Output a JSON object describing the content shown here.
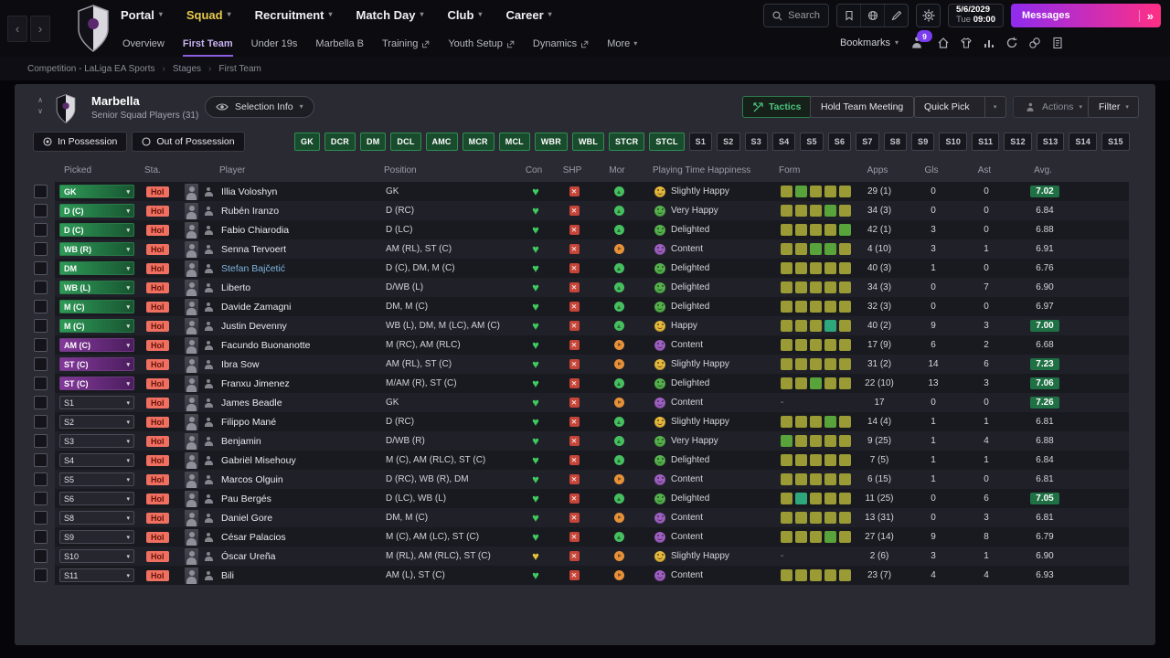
{
  "topbar": {
    "menus": [
      {
        "label": "Portal",
        "active": false
      },
      {
        "label": "Squad",
        "active": true
      },
      {
        "label": "Recruitment",
        "active": false
      },
      {
        "label": "Match Day",
        "active": false
      },
      {
        "label": "Club",
        "active": false
      },
      {
        "label": "Career",
        "active": false
      }
    ],
    "search_label": "Search",
    "icons": [
      "bookmark-icon",
      "globe-icon",
      "pencil-icon",
      "gear-icon"
    ],
    "date": {
      "date": "5/6/2029",
      "day": "Tue",
      "time": "09:00"
    },
    "messages_label": "Messages",
    "messages_arrows": "»"
  },
  "subnav": {
    "tabs": [
      {
        "label": "Overview",
        "selected": false,
        "external": false,
        "dropdown": false
      },
      {
        "label": "First Team",
        "selected": true,
        "external": false,
        "dropdown": false
      },
      {
        "label": "Under 19s",
        "selected": false,
        "external": false,
        "dropdown": false
      },
      {
        "label": "Marbella B",
        "selected": false,
        "external": false,
        "dropdown": false
      },
      {
        "label": "Training",
        "selected": false,
        "external": true,
        "dropdown": false
      },
      {
        "label": "Youth Setup",
        "selected": false,
        "external": true,
        "dropdown": false
      },
      {
        "label": "Dynamics",
        "selected": false,
        "external": true,
        "dropdown": false
      },
      {
        "label": "More",
        "selected": false,
        "external": false,
        "dropdown": true
      }
    ],
    "bookmarks_label": "Bookmarks",
    "notification_count": "9"
  },
  "breadcrumb": [
    "Competition - LaLiga EA Sports",
    "Stages",
    "First Team"
  ],
  "header": {
    "club_name": "Marbella",
    "subtitle": "Senior Squad Players (31)",
    "selection_info_label": "Selection Info",
    "tactics_label": "Tactics",
    "hold_meeting_label": "Hold Team Meeting",
    "quick_pick_label": "Quick Pick",
    "actions_label": "Actions",
    "filter_label": "Filter"
  },
  "possession": {
    "in_label": "In Possession",
    "out_label": "Out of Possession"
  },
  "filters": {
    "positions": [
      "GK",
      "DCR",
      "DM",
      "DCL",
      "AMC",
      "MCR",
      "MCL",
      "WBR",
      "WBL",
      "STCR",
      "STCL"
    ],
    "slots": [
      "S1",
      "S2",
      "S3",
      "S4",
      "S5",
      "S6",
      "S7",
      "S8",
      "S9",
      "S10",
      "S11",
      "S12",
      "S13",
      "S14",
      "S15"
    ]
  },
  "table": {
    "columns": [
      "Picked",
      "Sta.",
      "Player",
      "Position",
      "Con",
      "SHP",
      "Mor",
      "Playing Time Happiness",
      "Form",
      "Apps",
      "Gls",
      "Ast",
      "Avg."
    ],
    "form_empty": "-",
    "rows": [
      {
        "picked": "GK",
        "picked_color": "green",
        "sta": "Hol",
        "name": "Illia Voloshyn",
        "loan": false,
        "position": "GK",
        "con": "green",
        "mor": "green",
        "happiness": "Slightly Happy",
        "happiness_color": "yellow",
        "form": [
          "olive",
          "green",
          "olive",
          "olive",
          "olive"
        ],
        "apps": "29 (1)",
        "gls": "0",
        "ast": "0",
        "avg": "7.02",
        "avg_highlight": true
      },
      {
        "picked": "D (C)",
        "picked_color": "green",
        "sta": "Hol",
        "name": "Rubén Iranzo",
        "loan": false,
        "position": "D (RC)",
        "con": "green",
        "mor": "green",
        "happiness": "Very Happy",
        "happiness_color": "green",
        "form": [
          "olive",
          "olive",
          "olive",
          "green",
          "olive"
        ],
        "apps": "34 (3)",
        "gls": "0",
        "ast": "0",
        "avg": "6.84",
        "avg_highlight": false
      },
      {
        "picked": "D (C)",
        "picked_color": "green",
        "sta": "Hol",
        "name": "Fabio Chiarodia",
        "loan": false,
        "position": "D (LC)",
        "con": "green",
        "mor": "green",
        "happiness": "Delighted",
        "happiness_color": "green",
        "form": [
          "olive",
          "olive",
          "olive",
          "olive",
          "green"
        ],
        "apps": "42 (1)",
        "gls": "3",
        "ast": "0",
        "avg": "6.88",
        "avg_highlight": false
      },
      {
        "picked": "WB (R)",
        "picked_color": "green",
        "sta": "Hol",
        "name": "Senna Tervoert",
        "loan": false,
        "position": "AM (RL), ST (C)",
        "con": "green",
        "mor": "orange",
        "happiness": "Content",
        "happiness_color": "purple",
        "form": [
          "olive",
          "olive",
          "green",
          "green",
          "olive"
        ],
        "apps": "4 (10)",
        "gls": "3",
        "ast": "1",
        "avg": "6.91",
        "avg_highlight": false
      },
      {
        "picked": "DM",
        "picked_color": "green",
        "sta": "Hol",
        "name": "Stefan Bajčetić",
        "loan": true,
        "position": "D (C), DM, M (C)",
        "con": "green",
        "mor": "green",
        "happiness": "Delighted",
        "happiness_color": "green",
        "form": [
          "olive",
          "olive",
          "olive",
          "olive",
          "olive"
        ],
        "apps": "40 (3)",
        "gls": "1",
        "ast": "0",
        "avg": "6.76",
        "avg_highlight": false
      },
      {
        "picked": "WB (L)",
        "picked_color": "green",
        "sta": "Hol",
        "name": "Liberto",
        "loan": false,
        "position": "D/WB (L)",
        "con": "green",
        "mor": "green",
        "happiness": "Delighted",
        "happiness_color": "green",
        "form": [
          "olive",
          "olive",
          "olive",
          "olive",
          "olive"
        ],
        "apps": "34 (3)",
        "gls": "0",
        "ast": "7",
        "avg": "6.90",
        "avg_highlight": false
      },
      {
        "picked": "M (C)",
        "picked_color": "green",
        "sta": "Hol",
        "name": "Davide Zamagni",
        "loan": false,
        "position": "DM, M (C)",
        "con": "green",
        "mor": "green",
        "happiness": "Delighted",
        "happiness_color": "green",
        "form": [
          "olive",
          "olive",
          "olive",
          "olive",
          "olive"
        ],
        "apps": "32 (3)",
        "gls": "0",
        "ast": "0",
        "avg": "6.97",
        "avg_highlight": false
      },
      {
        "picked": "M (C)",
        "picked_color": "green",
        "sta": "Hol",
        "name": "Justin Devenny",
        "loan": false,
        "position": "WB (L), DM, M (LC), AM (C)",
        "con": "green",
        "mor": "green",
        "happiness": "Happy",
        "happiness_color": "yellow",
        "form": [
          "olive",
          "olive",
          "olive",
          "teal",
          "olive"
        ],
        "apps": "40 (2)",
        "gls": "9",
        "ast": "3",
        "avg": "7.00",
        "avg_highlight": true
      },
      {
        "picked": "AM (C)",
        "picked_color": "purple",
        "sta": "Hol",
        "name": "Facundo Buonanotte",
        "loan": false,
        "position": "M (RC), AM (RLC)",
        "con": "green",
        "mor": "orange",
        "happiness": "Content",
        "happiness_color": "purple",
        "form": [
          "olive",
          "olive",
          "olive",
          "olive",
          "olive"
        ],
        "apps": "17 (9)",
        "gls": "6",
        "ast": "2",
        "avg": "6.68",
        "avg_highlight": false
      },
      {
        "picked": "ST (C)",
        "picked_color": "purple",
        "sta": "Hol",
        "name": "Ibra Sow",
        "loan": false,
        "position": "AM (RL), ST (C)",
        "con": "green",
        "mor": "orange",
        "happiness": "Slightly Happy",
        "happiness_color": "yellow",
        "form": [
          "olive",
          "olive",
          "olive",
          "olive",
          "olive"
        ],
        "apps": "31 (2)",
        "gls": "14",
        "ast": "6",
        "avg": "7.23",
        "avg_highlight": true
      },
      {
        "picked": "ST (C)",
        "picked_color": "purple",
        "sta": "Hol",
        "name": "Franxu Jimenez",
        "loan": false,
        "position": "M/AM (R), ST (C)",
        "con": "green",
        "mor": "green",
        "happiness": "Delighted",
        "happiness_color": "green",
        "form": [
          "olive",
          "olive",
          "green",
          "olive",
          "olive"
        ],
        "apps": "22 (10)",
        "gls": "13",
        "ast": "3",
        "avg": "7.06",
        "avg_highlight": true
      },
      {
        "picked": "S1",
        "picked_color": "gray",
        "sta": "Hol",
        "name": "James Beadle",
        "loan": false,
        "position": "GK",
        "con": "green",
        "mor": "orange",
        "happiness": "Content",
        "happiness_color": "purple",
        "form": null,
        "apps": "17",
        "gls": "0",
        "ast": "0",
        "avg": "7.26",
        "avg_highlight": true
      },
      {
        "picked": "S2",
        "picked_color": "gray",
        "sta": "Hol",
        "name": "Filippo Mané",
        "loan": false,
        "position": "D (RC)",
        "con": "green",
        "mor": "green",
        "happiness": "Slightly Happy",
        "happiness_color": "yellow",
        "form": [
          "olive",
          "olive",
          "olive",
          "green",
          "olive"
        ],
        "apps": "14 (4)",
        "gls": "1",
        "ast": "1",
        "avg": "6.81",
        "avg_highlight": false
      },
      {
        "picked": "S3",
        "picked_color": "gray",
        "sta": "Hol",
        "name": "Benjamin",
        "loan": false,
        "position": "D/WB (R)",
        "con": "green",
        "mor": "green",
        "happiness": "Very Happy",
        "happiness_color": "green",
        "form": [
          "green",
          "olive",
          "olive",
          "olive",
          "olive"
        ],
        "apps": "9 (25)",
        "gls": "1",
        "ast": "4",
        "avg": "6.88",
        "avg_highlight": false
      },
      {
        "picked": "S4",
        "picked_color": "gray",
        "sta": "Hol",
        "name": "Gabriël Misehouy",
        "loan": false,
        "position": "M (C), AM (RLC), ST (C)",
        "con": "green",
        "mor": "green",
        "happiness": "Delighted",
        "happiness_color": "green",
        "form": [
          "olive",
          "olive",
          "olive",
          "olive",
          "olive"
        ],
        "apps": "7 (5)",
        "gls": "1",
        "ast": "1",
        "avg": "6.84",
        "avg_highlight": false
      },
      {
        "picked": "S5",
        "picked_color": "gray",
        "sta": "Hol",
        "name": "Marcos Olguin",
        "loan": false,
        "position": "D (RC), WB (R), DM",
        "con": "green",
        "mor": "orange",
        "happiness": "Content",
        "happiness_color": "purple",
        "form": [
          "olive",
          "olive",
          "olive",
          "olive",
          "olive"
        ],
        "apps": "6 (15)",
        "gls": "1",
        "ast": "0",
        "avg": "6.81",
        "avg_highlight": false
      },
      {
        "picked": "S6",
        "picked_color": "gray",
        "sta": "Hol",
        "name": "Pau Bergés",
        "loan": false,
        "position": "D (LC), WB (L)",
        "con": "green",
        "mor": "green",
        "happiness": "Delighted",
        "happiness_color": "green",
        "form": [
          "olive",
          "teal",
          "olive",
          "olive",
          "olive"
        ],
        "apps": "11 (25)",
        "gls": "0",
        "ast": "6",
        "avg": "7.05",
        "avg_highlight": true
      },
      {
        "picked": "S8",
        "picked_color": "gray",
        "sta": "Hol",
        "name": "Daniel Gore",
        "loan": false,
        "position": "DM, M (C)",
        "con": "green",
        "mor": "orange",
        "happiness": "Content",
        "happiness_color": "purple",
        "form": [
          "olive",
          "olive",
          "olive",
          "olive",
          "olive"
        ],
        "apps": "13 (31)",
        "gls": "0",
        "ast": "3",
        "avg": "6.81",
        "avg_highlight": false
      },
      {
        "picked": "S9",
        "picked_color": "gray",
        "sta": "Hol",
        "name": "César Palacios",
        "loan": false,
        "position": "M (C), AM (LC), ST (C)",
        "con": "green",
        "mor": "green",
        "happiness": "Content",
        "happiness_color": "purple",
        "form": [
          "olive",
          "olive",
          "olive",
          "green",
          "olive"
        ],
        "apps": "27 (14)",
        "gls": "9",
        "ast": "8",
        "avg": "6.79",
        "avg_highlight": false
      },
      {
        "picked": "S10",
        "picked_color": "gray",
        "sta": "Hol",
        "name": "Óscar Ureña",
        "loan": false,
        "position": "M (RL), AM (RLC), ST (C)",
        "con": "yellow",
        "mor": "orange",
        "happiness": "Slightly Happy",
        "happiness_color": "yellow",
        "form": null,
        "apps": "2 (6)",
        "gls": "3",
        "ast": "1",
        "avg": "6.90",
        "avg_highlight": false
      },
      {
        "picked": "S11",
        "picked_color": "gray",
        "sta": "Hol",
        "name": "Bili",
        "loan": false,
        "position": "AM (L), ST (C)",
        "con": "green",
        "mor": "orange",
        "happiness": "Content",
        "happiness_color": "purple",
        "form": [
          "olive",
          "olive",
          "olive",
          "olive",
          "olive"
        ],
        "apps": "23 (7)",
        "gls": "4",
        "ast": "4",
        "avg": "6.93",
        "avg_highlight": false
      }
    ]
  },
  "colors": {
    "accent_green": "#2f9b58",
    "accent_purple": "#84399c",
    "messages_gradient_start": "#8f2bf0",
    "messages_gradient_end": "#ff2f85",
    "status_badge": "#ef6f60",
    "avg_highlight": "#1f7044",
    "menu_active": "#e7c94c"
  }
}
